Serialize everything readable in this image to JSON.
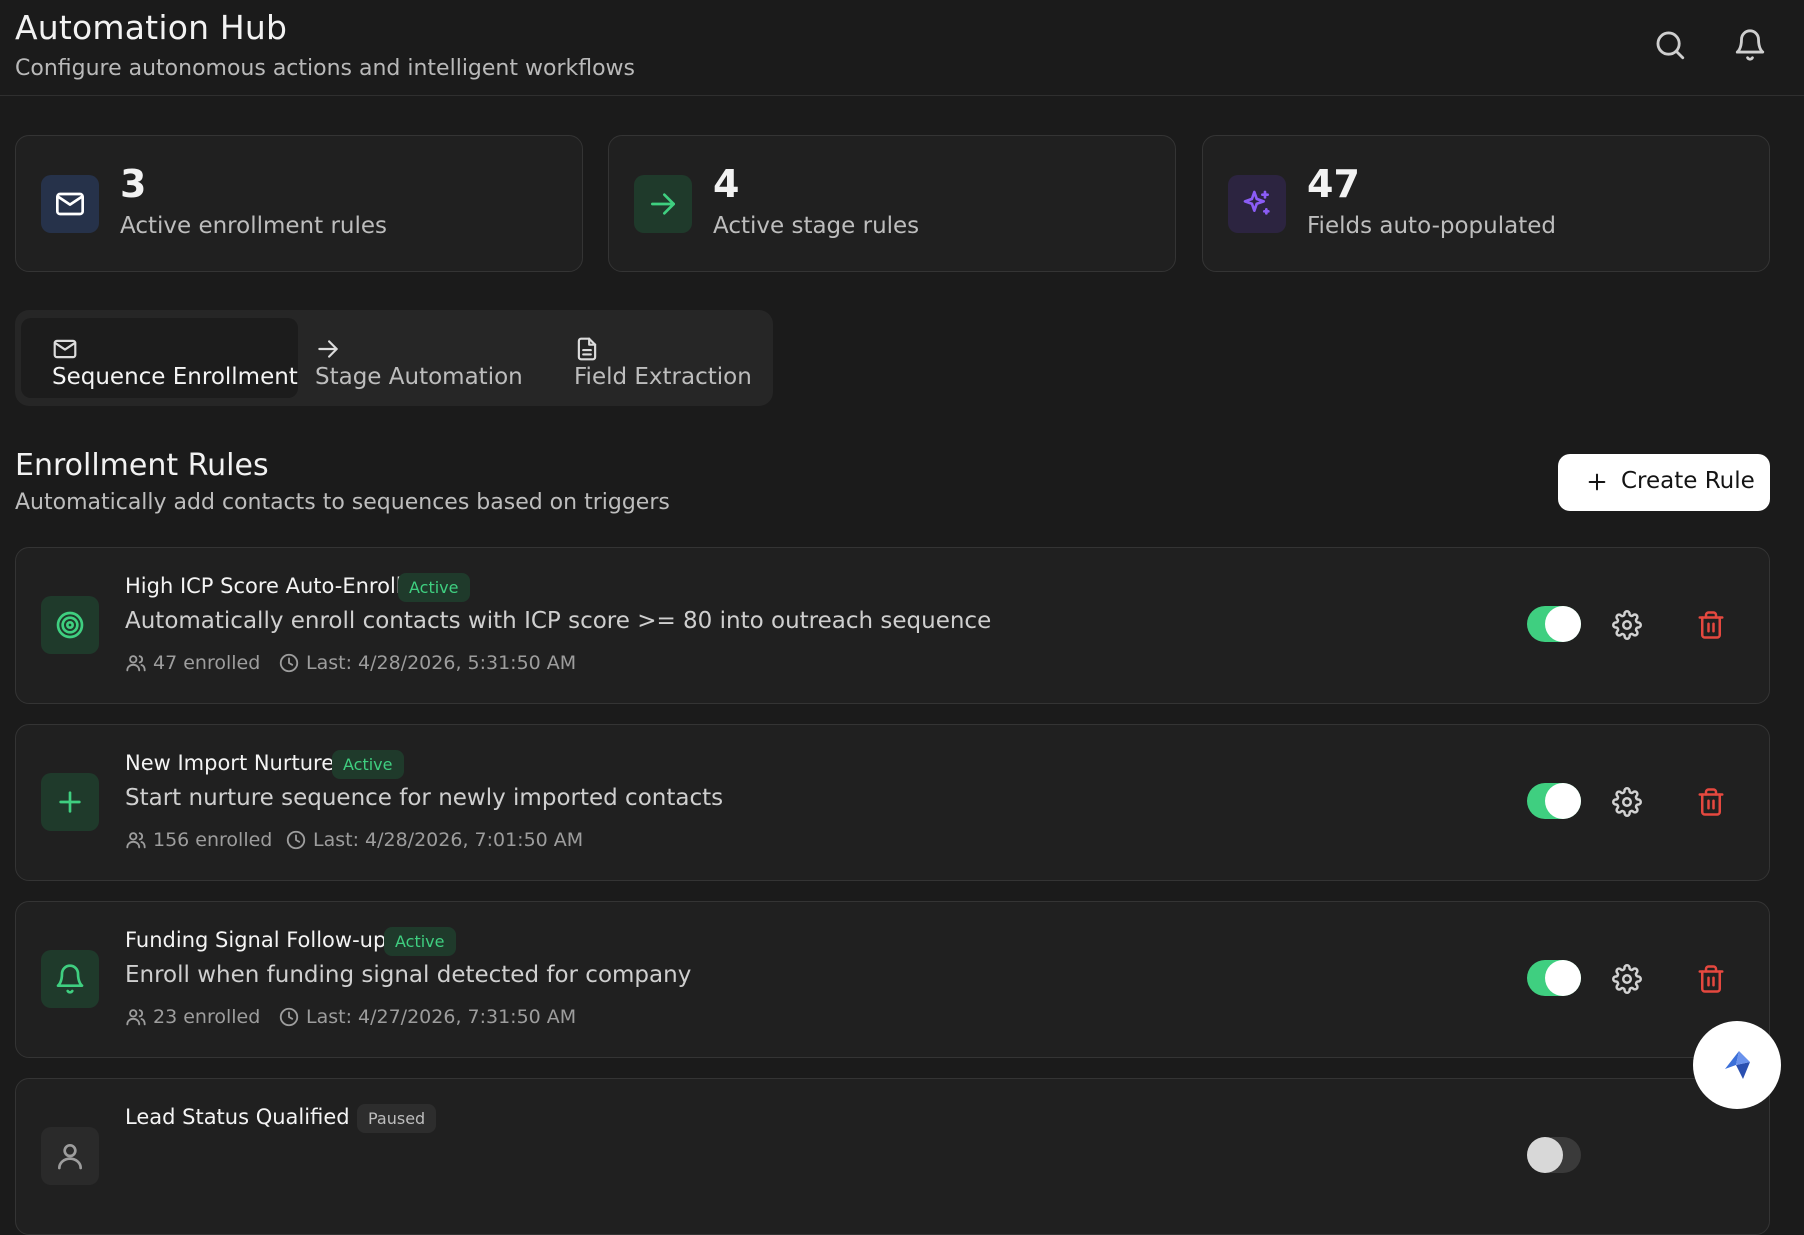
{
  "header": {
    "title": "Automation Hub",
    "subtitle": "Configure autonomous actions and intelligent workflows",
    "icons": [
      "search-icon",
      "bell-icon"
    ]
  },
  "stats": [
    {
      "value": "3",
      "label": "Active enrollment rules",
      "icon": "mail-icon",
      "icon_color": "#ffffff",
      "icon_bg": "#26324a"
    },
    {
      "value": "4",
      "label": "Active stage rules",
      "icon": "arrow-right-icon",
      "icon_color": "#3fcf80",
      "icon_bg": "#1f3a2b"
    },
    {
      "value": "47",
      "label": "Fields auto-populated",
      "icon": "sparkles-icon",
      "icon_color": "#8b5cf6",
      "icon_bg": "#2c2440"
    }
  ],
  "tabs": [
    {
      "label": "Sequence Enrollment",
      "icon": "mail-icon",
      "active": true
    },
    {
      "label": "Stage Automation",
      "icon": "arrow-right-icon",
      "active": false
    },
    {
      "label": "Field Extraction",
      "icon": "document-icon",
      "active": false
    }
  ],
  "section": {
    "title": "Enrollment Rules",
    "description": "Automatically add contacts to sequences based on triggers",
    "create_button": "Create Rule"
  },
  "rules": [
    {
      "name": "High ICP Score Auto-Enroll",
      "status": "Active",
      "description": "Automatically enroll contacts with ICP score >= 80 into outreach sequence",
      "enrolled": "47 enrolled",
      "last": "Last: 4/28/2026, 5:31:50 AM",
      "icon": "target-icon",
      "enabled": true
    },
    {
      "name": "New Import Nurture",
      "status": "Active",
      "description": "Start nurture sequence for newly imported contacts",
      "enrolled": "156 enrolled",
      "last": "Last: 4/28/2026, 7:01:50 AM",
      "icon": "plus-icon",
      "enabled": true
    },
    {
      "name": "Funding Signal Follow-up",
      "status": "Active",
      "description": "Enroll when funding signal detected for company",
      "enrolled": "23 enrolled",
      "last": "Last: 4/27/2026, 7:31:50 AM",
      "icon": "bell-icon",
      "enabled": true
    },
    {
      "name": "Lead Status Qualified",
      "status": "Paused",
      "icon": "user-icon",
      "enabled": false
    }
  ],
  "colors": {
    "background": "#1b1b1b",
    "card": "#202020",
    "accent_green": "#3fcf80",
    "danger": "#e5483f",
    "toggle_on": "#3fcf80"
  },
  "fab": {
    "icon": "assistant-logo-icon"
  }
}
